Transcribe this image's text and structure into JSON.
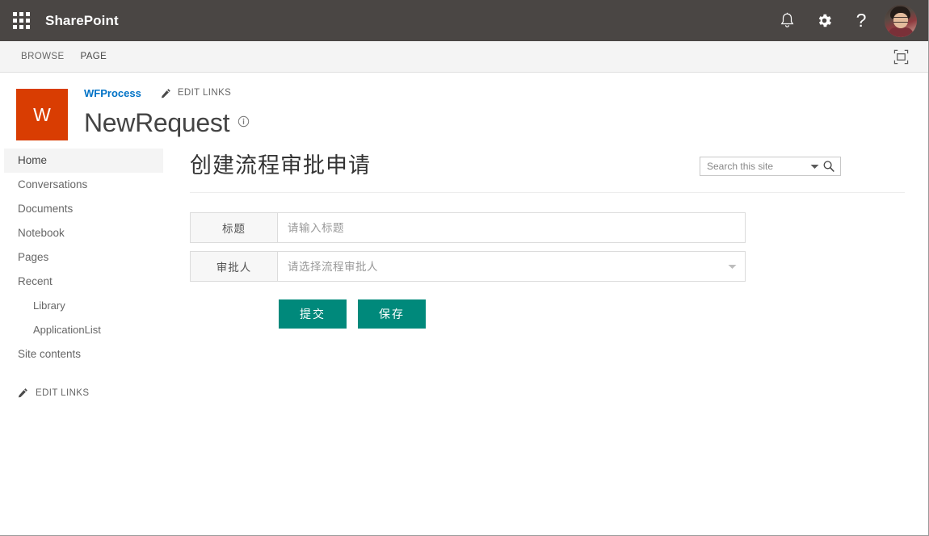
{
  "suitebar": {
    "app_launcher_icon": "waffle-grid-icon",
    "brand": "SharePoint",
    "notifications_icon": "bell-icon",
    "settings_icon": "gear-icon",
    "help_icon": "question-mark-icon",
    "help_glyph": "?",
    "avatar_label": "user-avatar"
  },
  "ribbon": {
    "tabs": [
      {
        "label": "BROWSE",
        "active": false
      },
      {
        "label": "PAGE",
        "active": true
      }
    ],
    "focus_icon": "focus-on-content-icon"
  },
  "site_header": {
    "logo_letter": "W",
    "logo_color": "#d93d02",
    "breadcrumb": "WFProcess",
    "edit_links_label": "EDIT LINKS",
    "edit_links_icon": "pencil-icon",
    "page_title": "NewRequest",
    "info_icon": "info-circle-icon"
  },
  "search": {
    "placeholder": "Search this site",
    "value": "",
    "caret_icon": "chevron-down-icon",
    "go_icon": "magnifier-icon"
  },
  "sidebar": {
    "items": [
      {
        "label": "Home",
        "selected": true,
        "sub": false
      },
      {
        "label": "Conversations",
        "selected": false,
        "sub": false
      },
      {
        "label": "Documents",
        "selected": false,
        "sub": false
      },
      {
        "label": "Notebook",
        "selected": false,
        "sub": false
      },
      {
        "label": "Pages",
        "selected": false,
        "sub": false
      },
      {
        "label": "Recent",
        "selected": false,
        "sub": false
      },
      {
        "label": "Library",
        "selected": false,
        "sub": true
      },
      {
        "label": "ApplicationList",
        "selected": false,
        "sub": true
      },
      {
        "label": "Site contents",
        "selected": false,
        "sub": false
      }
    ],
    "edit_links_label": "EDIT LINKS",
    "edit_links_icon": "pencil-icon"
  },
  "form": {
    "heading": "创建流程审批申请",
    "fields": [
      {
        "label": "标题",
        "placeholder": "请输入标题",
        "value": "",
        "type": "text"
      },
      {
        "label": "审批人",
        "placeholder": "请选择流程审批人",
        "value": "",
        "type": "select",
        "caret_icon": "chevron-down-icon"
      }
    ],
    "buttons": [
      {
        "label": "提交",
        "name": "submit-button"
      },
      {
        "label": "保存",
        "name": "save-button"
      }
    ],
    "accent_color": "#00897b"
  }
}
